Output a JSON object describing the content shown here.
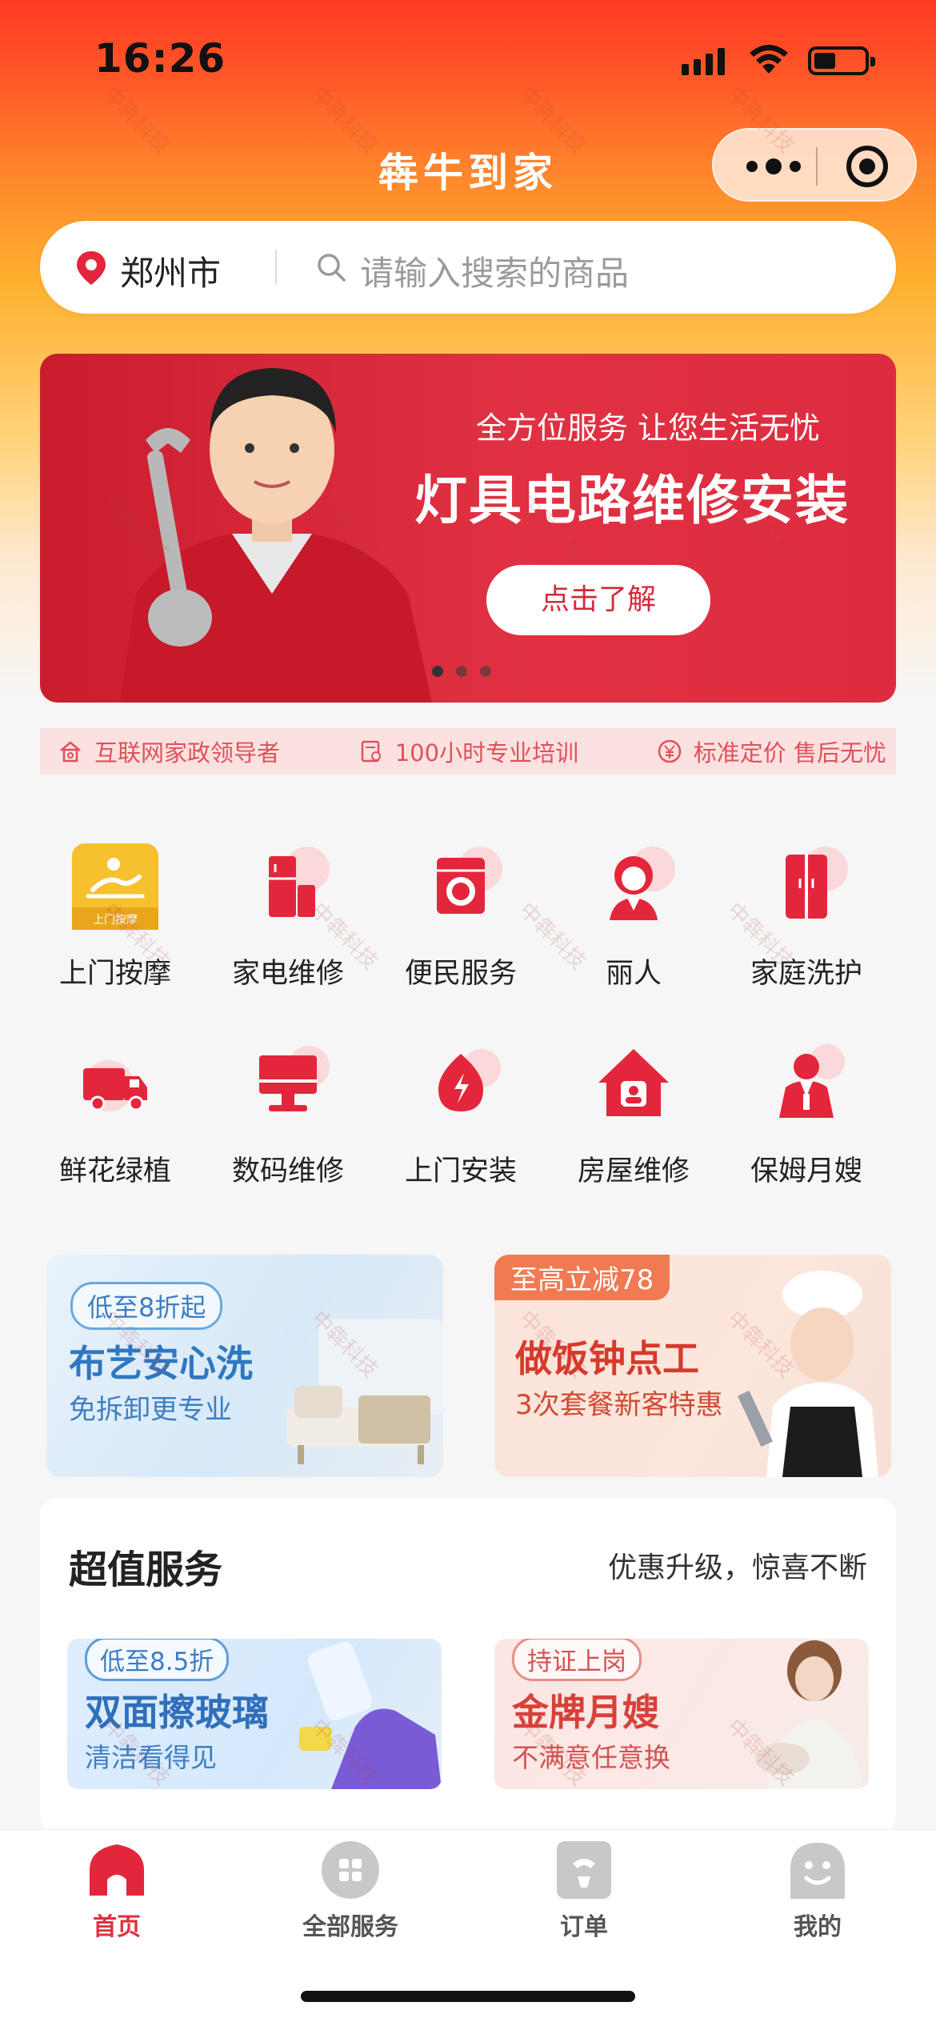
{
  "status_bar": {
    "time": "16:26"
  },
  "app": {
    "title": "犇牛到家"
  },
  "search": {
    "city": "郑州市",
    "placeholder": "请输入搜索的商品"
  },
  "banner": {
    "slogan": "全方位服务 让您生活无忧",
    "headline": "灯具电路维修安装",
    "button_label": "点击了解"
  },
  "features": [
    {
      "label": "互联网家政领导者",
      "icon": "house-icon"
    },
    {
      "label": "100小时专业培训",
      "icon": "certificate-icon"
    },
    {
      "label": "标准定价 售后无忧",
      "icon": "yen-icon"
    }
  ],
  "categories": [
    {
      "label": "上门按摩",
      "icon": "massage-icon",
      "icon_text": "上门按摩"
    },
    {
      "label": "家电维修",
      "icon": "appliance-icon"
    },
    {
      "label": "便民服务",
      "icon": "washing-machine-icon"
    },
    {
      "label": "丽人",
      "icon": "woman-icon"
    },
    {
      "label": "家庭洗护",
      "icon": "wardrobe-icon"
    },
    {
      "label": "鲜花绿植",
      "icon": "truck-icon"
    },
    {
      "label": "数码维修",
      "icon": "monitor-icon"
    },
    {
      "label": "上门安装",
      "icon": "lightning-icon"
    },
    {
      "label": "房屋维修",
      "icon": "house-repair-icon"
    },
    {
      "label": "保姆月嫂",
      "icon": "nanny-icon"
    }
  ],
  "promos": [
    {
      "tag": "低至8折起",
      "title": "布艺安心洗",
      "subtitle": "免拆卸更专业"
    },
    {
      "tag": "至高立减78",
      "title": "做饭钟点工",
      "subtitle": "3次套餐新客特惠"
    }
  ],
  "value_section": {
    "title": "超值服务",
    "subtitle": "优惠升级，惊喜不断",
    "cards": [
      {
        "tag": "低至8.5折",
        "title": "双面擦玻璃",
        "subtitle": "清洁看得见"
      },
      {
        "tag": "持证上岗",
        "title": "金牌月嫂",
        "subtitle": "不满意任意换"
      }
    ]
  },
  "tabbar": [
    {
      "label": "首页",
      "icon": "home-icon",
      "active": true
    },
    {
      "label": "全部服务",
      "icon": "grid-icon",
      "active": false
    },
    {
      "label": "订单",
      "icon": "order-icon",
      "active": false
    },
    {
      "label": "我的",
      "icon": "profile-icon",
      "active": false
    }
  ],
  "watermark": "中犇科技",
  "colors": {
    "brand_red": "#e03040",
    "accent_orange": "#ff8a2c",
    "promo_blue": "#2f77c0"
  }
}
